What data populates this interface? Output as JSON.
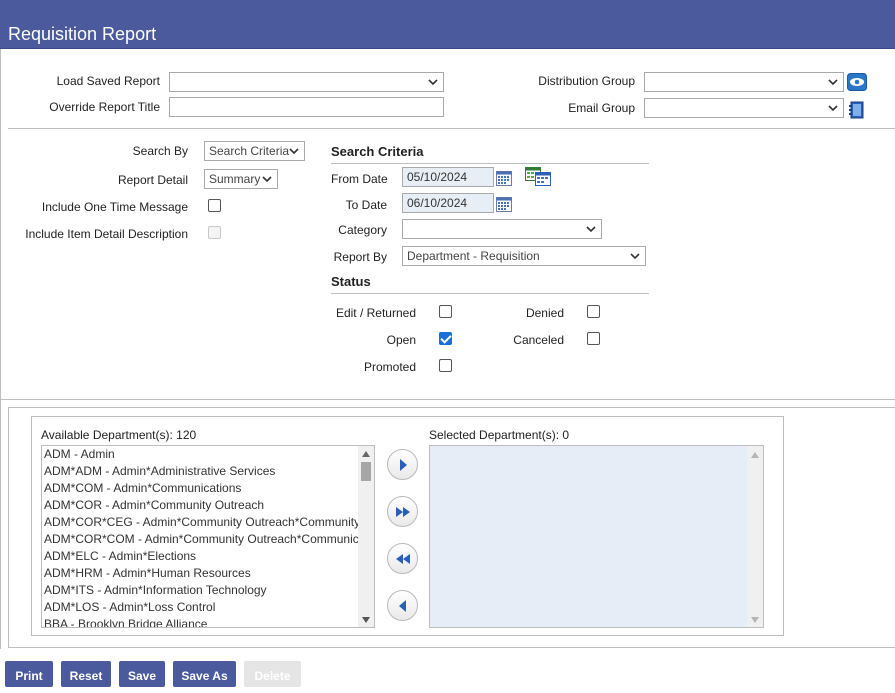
{
  "header": {
    "title": "Requisition Report"
  },
  "top_form": {
    "load_saved_report": {
      "label": "Load Saved Report",
      "value": ""
    },
    "override_report_title": {
      "label": "Override Report Title",
      "value": ""
    },
    "distribution_group": {
      "label": "Distribution Group",
      "value": ""
    },
    "email_group": {
      "label": "Email Group",
      "value": ""
    }
  },
  "options": {
    "search_by": {
      "label": "Search By",
      "value": "Search Criteria"
    },
    "report_detail": {
      "label": "Report Detail",
      "value": "Summary"
    },
    "include_one_time_message": {
      "label": "Include One Time Message",
      "checked": false
    },
    "include_item_detail_description": {
      "label": "Include Item Detail Description",
      "checked": false,
      "disabled": true
    }
  },
  "search_criteria": {
    "title": "Search Criteria",
    "from_date": {
      "label": "From Date",
      "value": "05/10/2024"
    },
    "to_date": {
      "label": "To Date",
      "value": "06/10/2024"
    },
    "category": {
      "label": "Category",
      "value": ""
    },
    "report_by": {
      "label": "Report By",
      "value": "Department - Requisition"
    }
  },
  "status": {
    "title": "Status",
    "edit_returned": {
      "label": "Edit / Returned",
      "checked": false
    },
    "denied": {
      "label": "Denied",
      "checked": false
    },
    "open": {
      "label": "Open",
      "checked": true
    },
    "canceled": {
      "label": "Canceled",
      "checked": false
    },
    "promoted": {
      "label": "Promoted",
      "checked": false
    }
  },
  "departments": {
    "available_label": "Available Department(s): 120",
    "selected_label": "Selected Department(s): 0",
    "available_items": [
      "ADM - Admin",
      "ADM*ADM - Admin*Administrative Services",
      "ADM*COM - Admin*Communications",
      "ADM*COR - Admin*Community Outreach",
      "ADM*COR*CEG - Admin*Community Outreach*Community",
      "ADM*COR*COM - Admin*Community Outreach*Communic",
      "ADM*ELC - Admin*Elections",
      "ADM*HRM - Admin*Human Resources",
      "ADM*ITS - Admin*Information Technology",
      "ADM*LOS - Admin*Loss Control",
      "BBA - Brooklyn Bridge Alliance"
    ],
    "selected_items": []
  },
  "buttons": {
    "print": "Print",
    "reset": "Reset",
    "save": "Save",
    "save_as": "Save As",
    "delete": "Delete"
  },
  "colors": {
    "header": "#4a5a9c",
    "button": "#4a5a9c",
    "date_field": "#e8eef6",
    "selected_list": "#e6edf6",
    "checkbox_checked": "#1a6fd6"
  },
  "icons": {
    "distribution_group": "eye-icon",
    "email_group": "address-book-icon",
    "from_date": "calendar-icon",
    "to_date": "calendar-icon",
    "date_range": "calendar-range-icon"
  }
}
